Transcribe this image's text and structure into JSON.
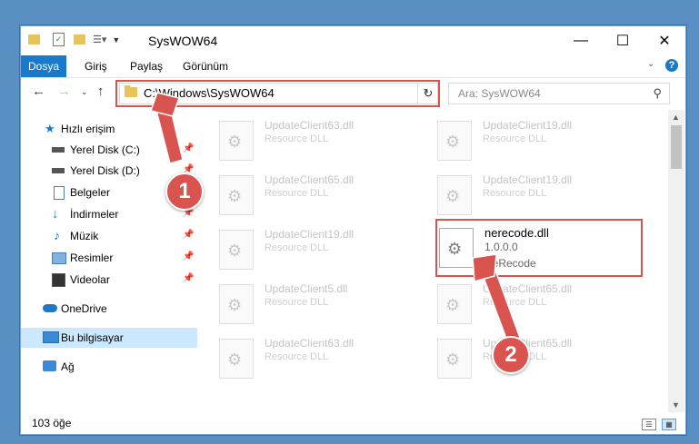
{
  "window": {
    "title": "SysWOW64"
  },
  "ribbon": {
    "tabs": [
      "Dosya",
      "Giriş",
      "Paylaş",
      "Görünüm"
    ],
    "help": "?"
  },
  "address": {
    "path": "C:\\Windows\\SysWOW64",
    "search_placeholder": "Ara: SysWOW64"
  },
  "sidebar": {
    "items": [
      {
        "label": "Hızlı erişim",
        "icon": "star-icon"
      },
      {
        "label": "Yerel Disk (C:)",
        "icon": "drive-icon"
      },
      {
        "label": "Yerel Disk (D:)",
        "icon": "drive-icon"
      },
      {
        "label": "Belgeler",
        "icon": "documents-icon"
      },
      {
        "label": "İndirmeler",
        "icon": "download-icon"
      },
      {
        "label": "Müzik",
        "icon": "music-icon"
      },
      {
        "label": "Resimler",
        "icon": "pictures-icon"
      },
      {
        "label": "Videolar",
        "icon": "videos-icon"
      },
      {
        "label": "OneDrive",
        "icon": "cloud-icon"
      },
      {
        "label": "Bu bilgisayar",
        "icon": "computer-icon"
      },
      {
        "label": "Ağ",
        "icon": "network-icon"
      }
    ]
  },
  "files": [
    {
      "name": "UpdateClient63.dll",
      "desc": "Resource DLL"
    },
    {
      "name": "UpdateClient19.dll",
      "desc": "Resource DLL"
    },
    {
      "name": "UpdateClient65.dll",
      "desc": "Resource DLL"
    },
    {
      "name": "UpdateClient19.dll",
      "desc": "Resource DLL"
    },
    {
      "name": "UpdateClient19.dll",
      "desc": "Resource DLL"
    },
    {
      "name": "nerecode.dll",
      "version": "1.0.0.0",
      "desc": "NeRecode"
    },
    {
      "name": "UpdateClient5.dll",
      "desc": "Resource DLL"
    },
    {
      "name": "UpdateClient65.dll",
      "desc": "Resource DLL"
    },
    {
      "name": "UpdateClient63.dll",
      "desc": "Resource DLL"
    },
    {
      "name": "UpdateClient65.dll",
      "desc": "Resource DLL"
    }
  ],
  "status": {
    "count": "103 öğe"
  },
  "annotations": {
    "step1": "1",
    "step2": "2",
    "color": "#d9534f"
  }
}
